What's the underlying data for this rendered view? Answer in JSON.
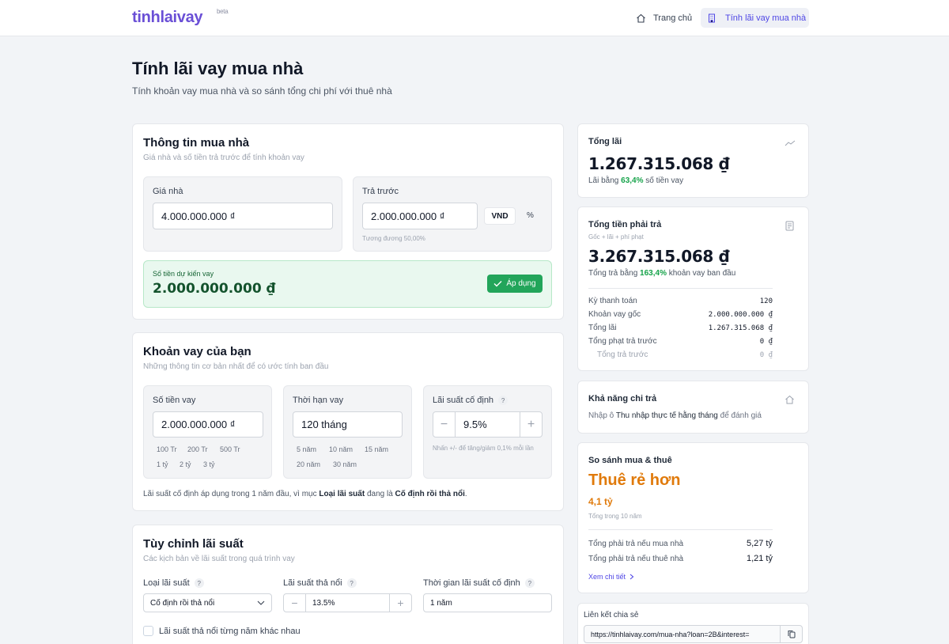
{
  "header": {
    "logo": "tinhlaivay",
    "beta": "beta",
    "nav_home": "Trang chủ",
    "nav_active": "Tính lãi vay mua nhà"
  },
  "page": {
    "title": "Tính lãi vay mua nhà",
    "subtitle": "Tính khoản vay mua nhà và so sánh tổng chi phí với thuê nhà"
  },
  "house_info": {
    "title": "Thông tin mua nhà",
    "subtitle": "Giá nhà và số tiền trả trước để tính khoản vay",
    "price_label": "Giá nhà",
    "price_value": "4.000.000.000 ₫",
    "down_label": "Trả trước",
    "down_value": "2.000.000.000 ₫",
    "unit_vnd": "VND",
    "unit_pct": "%",
    "down_hint": "Tương đương 50,00%",
    "est_label": "Số tiền dự kiến vay",
    "est_value": "2.000.000.000 ₫",
    "apply": "Áp dụng"
  },
  "loan": {
    "title": "Khoản vay của bạn",
    "subtitle": "Những thông tin cơ bản nhất để có ước tính ban đầu",
    "amount_label": "Số tiền vay",
    "amount_value": "2.000.000.000 ₫",
    "amount_chips": [
      "100 Tr",
      "200 Tr",
      "500 Tr",
      "1 tỷ",
      "2 tỷ",
      "3 tỷ"
    ],
    "term_label": "Thời hạn vay",
    "term_value": "120 tháng",
    "term_chips": [
      "5 năm",
      "10 năm",
      "15 năm",
      "20 năm",
      "30 năm"
    ],
    "rate_label": "Lãi suất cố định",
    "rate_value": "9.5%",
    "rate_hint": "Nhấn +/- để tăng/giảm 0,1% mỗi lần",
    "note_a": "Lãi suất cố định áp dụng trong 1 năm đầu, vì mục ",
    "note_b": "Loại lãi suất",
    "note_c": " đang là ",
    "note_d": "Cố định rồi thả nổi",
    "note_e": "."
  },
  "custom": {
    "title": "Tùy chỉnh lãi suất",
    "subtitle": "Các kịch bản về lãi suất trong quá trình vay",
    "type_label": "Loại lãi suất",
    "type_value": "Cố định rồi thả nổi",
    "float_label": "Lãi suất thả nổi",
    "float_value": "13.5%",
    "fixed_time_label": "Thời gian lãi suất cố định",
    "fixed_time_value": "1 năm",
    "checkbox_label": "Lãi suất thả nổi từng năm khác nhau"
  },
  "total_interest": {
    "label": "Tổng lãi",
    "value": "1.267.315.068 ₫",
    "note_a": "Lãi bằng ",
    "note_pct": "63,4%",
    "note_b": " số tiền vay"
  },
  "total_payment": {
    "label": "Tổng tiền phải trả",
    "sub": "Gốc + lãi + phí phạt",
    "value": "3.267.315.068 ₫",
    "note_a": "Tổng trả bằng ",
    "note_pct": "163,4%",
    "note_b": " khoản vay ban đầu",
    "rows": [
      {
        "label": "Kỳ thanh toán",
        "value": "120"
      },
      {
        "label": "Khoản vay gốc",
        "value": "2.000.000.000 ₫"
      },
      {
        "label": "Tổng lãi",
        "value": "1.267.315.068 ₫"
      },
      {
        "label": "Tổng phạt trả trước",
        "value": "0 ₫"
      },
      {
        "label": "Tổng trả trước",
        "value": "0 ₫"
      }
    ]
  },
  "affordability": {
    "label": "Khả năng chi trả",
    "note_a": "Nhập ô ",
    "note_b": "Thu nhập thực tế hằng tháng",
    "note_c": " để đánh giá"
  },
  "compare": {
    "label": "So sánh mua & thuê",
    "headline": "Thuê rẻ hơn",
    "amount": "4,1 tỷ",
    "period": "Tổng trong 10 năm",
    "buy_label": "Tổng phải trả nếu mua nhà",
    "buy_value": "5,27 tỷ",
    "rent_label": "Tổng phải trả nếu thuê nhà",
    "rent_value": "1,21 tỷ",
    "details": "Xem chi tiết"
  },
  "share": {
    "label": "Liên kết chia sẻ",
    "url": "https://tinhlaivay.com/mua-nha?loan=2B&interest="
  },
  "colors": {
    "brand": "#6a4fd6",
    "green": "#22a55a",
    "orange": "#e07a0b"
  }
}
